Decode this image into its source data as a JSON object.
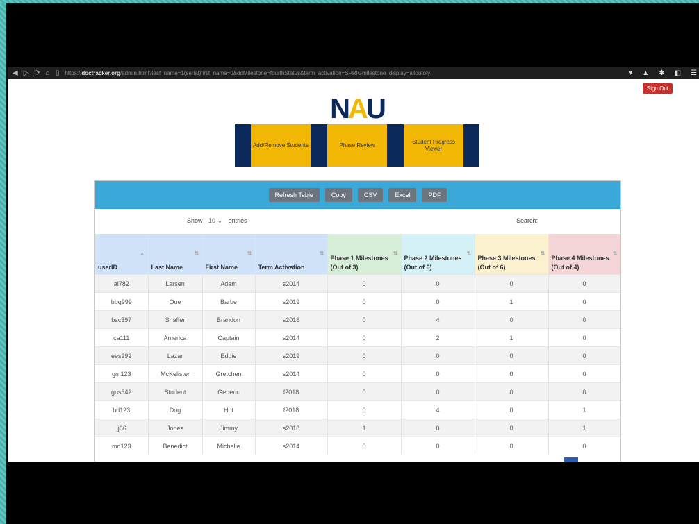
{
  "browser": {
    "url_domain": "doctracker.org",
    "url_rest": "/admin.html?last_name=1(serial)first_name=0&ddMilestone=fourthStatus&term_activation=SPRIGmilestone_display=alloutofy",
    "nav_icons": [
      "back-icon",
      "forward-icon",
      "reload-icon",
      "home-icon",
      "bookmark-icon"
    ]
  },
  "header": {
    "signout_label": "Sign Out",
    "logo_left": "N",
    "logo_accent": "A",
    "logo_right": "U"
  },
  "nav": {
    "items": [
      {
        "label": "Add/Remove Students"
      },
      {
        "label": "Phase Review"
      },
      {
        "label": "Student Progress Viewer"
      }
    ]
  },
  "toolbar": {
    "refresh": "Refresh Table",
    "copy": "Copy",
    "csv": "CSV",
    "excel": "Excel",
    "pdf": "PDF"
  },
  "controls": {
    "show_label": "Show",
    "show_value": "10",
    "entries_label": "entries",
    "search_label": "Search:"
  },
  "table": {
    "columns": [
      "userID",
      "Last Name",
      "First Name",
      "Term Activation",
      "Phase 1 Milestones (Out of 3)",
      "Phase 2 Milestones (Out of 6)",
      "Phase 3 Milestones (Out of 6)",
      "Phase 4 Milestones (Out of 4)"
    ],
    "rows": [
      [
        "al782",
        "Larsen",
        "Adam",
        "s2014",
        "0",
        "0",
        "0",
        "0"
      ],
      [
        "bbq999",
        "Que",
        "Barbe",
        "s2019",
        "0",
        "0",
        "1",
        "0"
      ],
      [
        "bsc397",
        "Shaffer",
        "Brandon",
        "s2018",
        "0",
        "4",
        "0",
        "0"
      ],
      [
        "ca111",
        "America",
        "Captain",
        "s2014",
        "0",
        "2",
        "1",
        "0"
      ],
      [
        "ees292",
        "Lazar",
        "Eddie",
        "s2019",
        "0",
        "0",
        "0",
        "0"
      ],
      [
        "gm123",
        "McKelister",
        "Gretchen",
        "s2014",
        "0",
        "0",
        "0",
        "0"
      ],
      [
        "gns342",
        "Student",
        "Generic",
        "f2018",
        "0",
        "0",
        "0",
        "0"
      ],
      [
        "hd123",
        "Dog",
        "Hot",
        "f2018",
        "0",
        "4",
        "0",
        "1"
      ],
      [
        "jj66",
        "Jones",
        "Jimmy",
        "s2018",
        "1",
        "0",
        "0",
        "1"
      ],
      [
        "md123",
        "Benedict",
        "Michelle",
        "s2014",
        "0",
        "0",
        "0",
        "0"
      ]
    ]
  }
}
